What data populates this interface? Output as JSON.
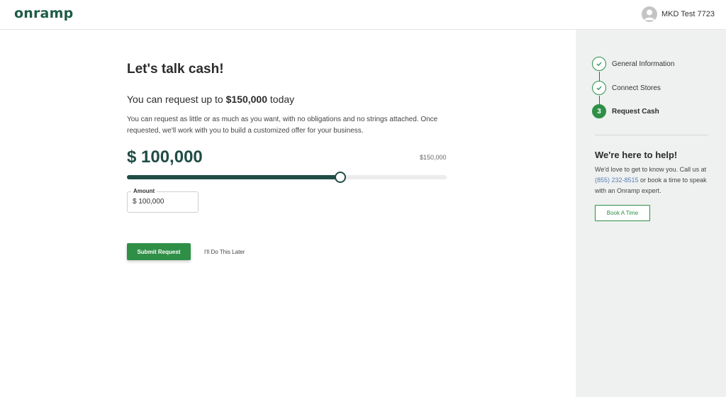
{
  "header": {
    "logo_text": "onramp",
    "user_name": "MKD Test 7723",
    "avatar_icon": "user-avatar-icon"
  },
  "main": {
    "title": "Let's talk cash!",
    "subtitle_prefix": "You can request up to ",
    "subtitle_amount": "$150,000",
    "subtitle_suffix": " today",
    "description": "You can request as little or as much as you want, with no obligations and no strings attached. Once requested, we'll work with you to build a customized offer for your business.",
    "amount_display": "$ 100,000",
    "max_label": "$150,000",
    "slider": {
      "value": 100000,
      "max": 150000,
      "fraction": 0.667
    },
    "amount_field": {
      "label": "Amount",
      "value": "$ 100,000"
    },
    "submit_label": "Submit Request",
    "later_label": "I'll Do This Later"
  },
  "sidebar": {
    "steps": [
      {
        "label": "General Information",
        "status": "complete",
        "icon": "check-icon"
      },
      {
        "label": "Connect Stores",
        "status": "complete",
        "icon": "check-icon"
      },
      {
        "label": "Request Cash",
        "status": "active",
        "number": "3"
      }
    ],
    "help_title": "We're here to help!",
    "help_text_1": "We'd love to get to know you. Call us at ",
    "help_phone": "(855) 232-8515",
    "help_text_2": " or book a time to speak with an Onramp expert.",
    "book_label": "Book A Time"
  },
  "colors": {
    "brand_dark": "#1f4d45",
    "brand_green": "#2f8f47",
    "sidebar_bg": "#eef1f0",
    "link": "#5a7fb7"
  }
}
